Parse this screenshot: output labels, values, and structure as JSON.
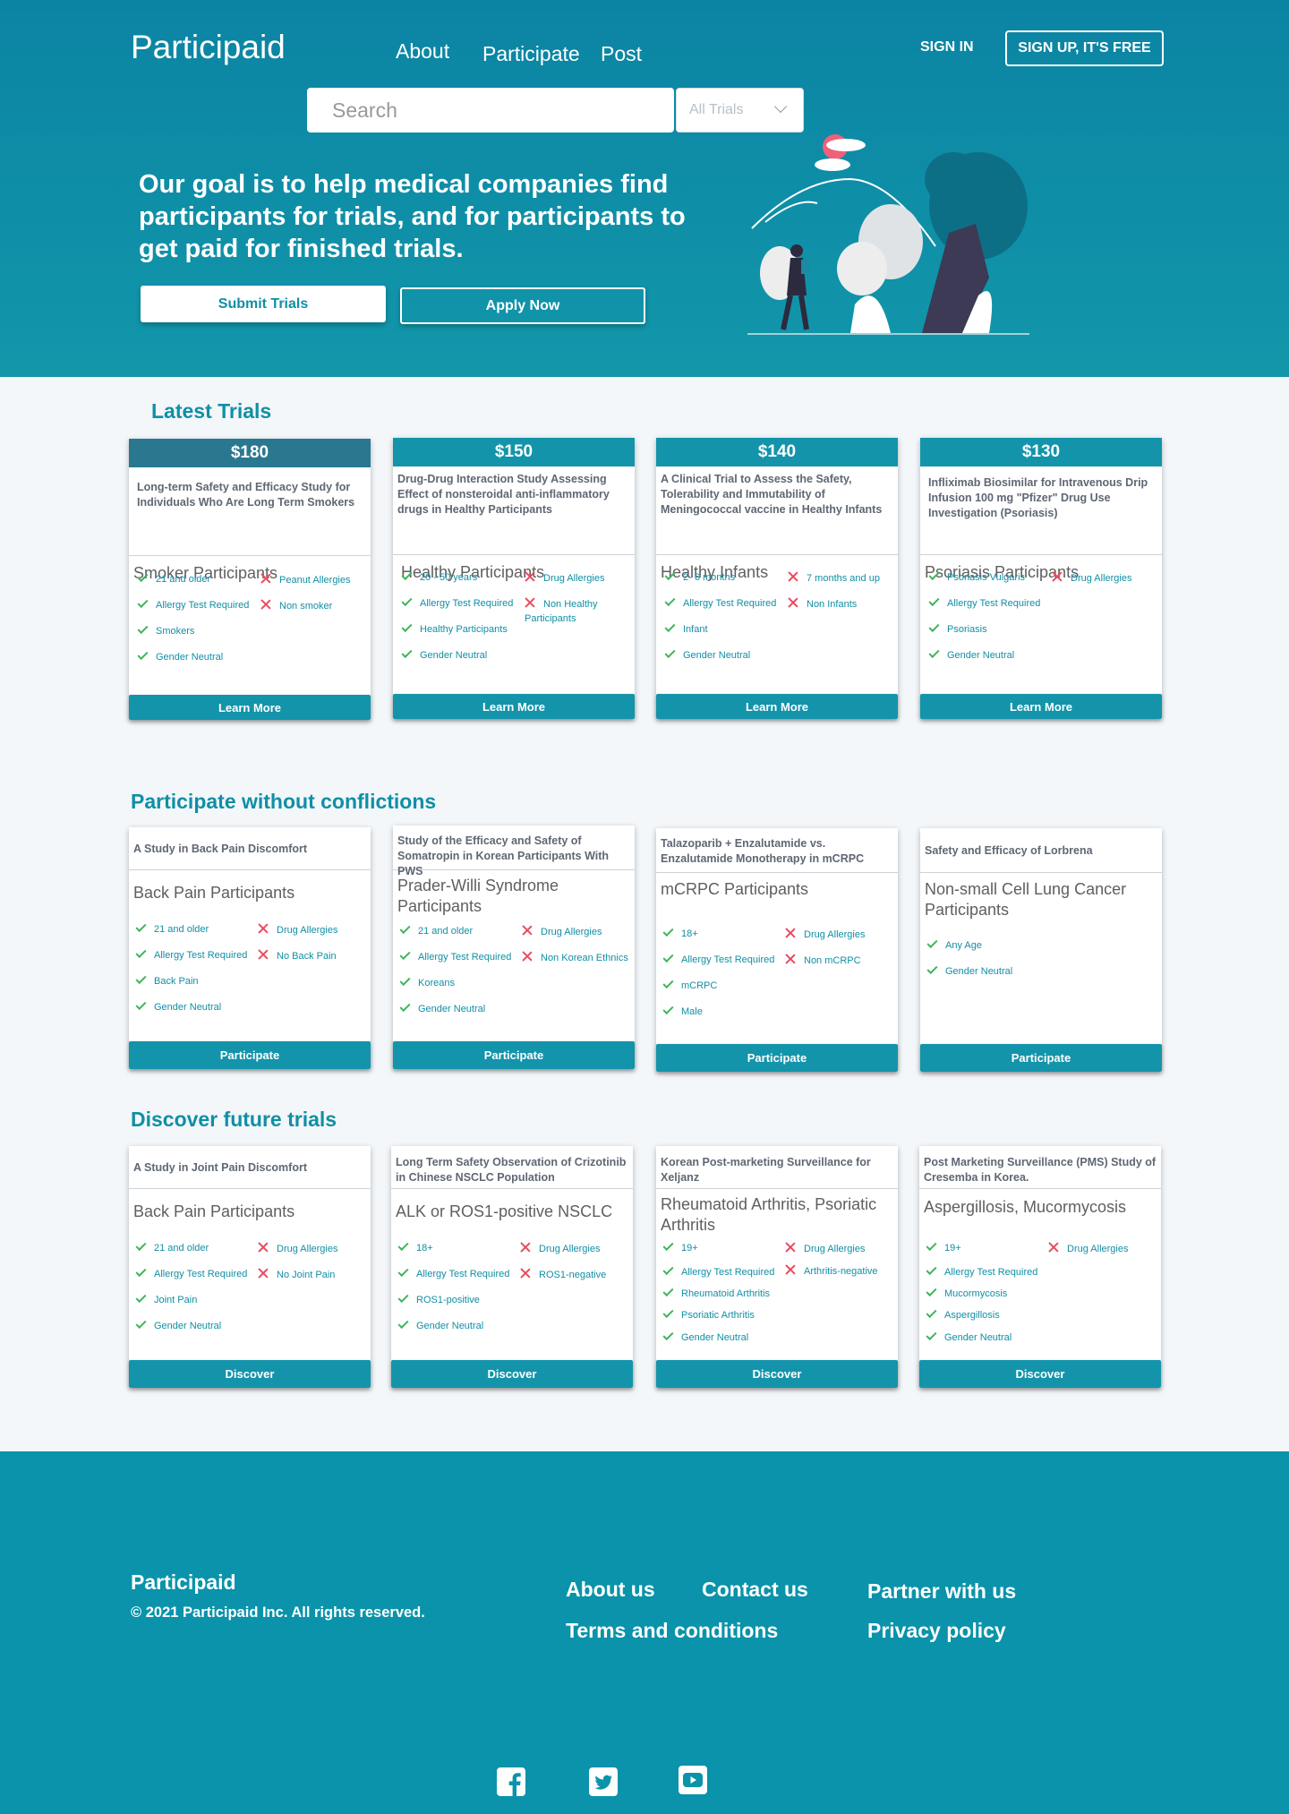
{
  "brand": "Participaid",
  "nav": {
    "about": "About",
    "participate": "Participate",
    "post": "Post"
  },
  "auth": {
    "sign_in": "SIGN IN",
    "sign_up": "SIGN UP, IT'S FREE"
  },
  "search": {
    "placeholder": "Search",
    "filter_value": "All Trials"
  },
  "hero": {
    "headline": "Our goal is to help medical companies find participants for trials, and for participants to get paid for finished trials.",
    "submit_label": "Submit Trials",
    "apply_label": "Apply Now"
  },
  "colors": {
    "primary": "#1394ab",
    "check": "#3eb45a",
    "cross": "#e84a5f",
    "bg": "#f3f7fa"
  },
  "latest": {
    "title": "Latest Trials",
    "cards": [
      {
        "price": "$180",
        "desc": "Long-term Safety and Efficacy Study for Individuals Who Are Long Term Smokers",
        "group": "Smoker Participants",
        "includes": [
          "21 and older",
          "Allergy Test Required",
          "Smokers",
          "Gender Neutral"
        ],
        "excludes": [
          "Peanut Allergies",
          "Non smoker"
        ],
        "button": "Learn More"
      },
      {
        "price": "$150",
        "desc": "Drug-Drug Interaction Study Assessing Effect of nonsteroidal anti-inflammatory drugs in Healthy Participants",
        "group": "Healthy Participants",
        "includes": [
          "20 - 50 years",
          "Allergy Test Required",
          "Healthy Participants",
          "Gender Neutral"
        ],
        "excludes": [
          "Drug Allergies",
          "Non Healthy Participants"
        ],
        "button": "Learn More"
      },
      {
        "price": "$140",
        "desc": "A Clinical Trial to Assess the Safety, Tolerability and Immutability of Meningococcal vaccine in Healthy Infants",
        "group": "Healthy Infants",
        "includes": [
          "2- 6 months",
          "Allergy Test Required",
          "Infant",
          "Gender Neutral"
        ],
        "excludes": [
          "7 months and up",
          "Non Infants"
        ],
        "button": "Learn More"
      },
      {
        "price": "$130",
        "desc": "Infliximab Biosimilar for Intravenous Drip Infusion 100 mg \"Pfizer\" Drug Use Investigation (Psoriasis)",
        "group": "Psoriasis Participants",
        "includes": [
          "Psoriasis Vulgaris",
          "Allergy Test Required",
          "Psoriasis",
          "Gender Neutral"
        ],
        "excludes": [
          "Drug Allergies"
        ],
        "button": "Learn More"
      }
    ]
  },
  "participate": {
    "title": "Participate without conflictions",
    "cards": [
      {
        "desc": "A Study in Back Pain Discomfort",
        "group": "Back Pain Participants",
        "includes": [
          "21 and older",
          "Allergy Test Required",
          "Back Pain",
          "Gender Neutral"
        ],
        "excludes": [
          "Drug Allergies",
          "No Back Pain"
        ],
        "button": "Participate"
      },
      {
        "desc": "Study of the Efficacy and Safety of Somatropin in Korean Participants With PWS",
        "group": "Prader-Willi Syndrome Participants",
        "includes": [
          "21 and older",
          "Allergy Test Required",
          "Koreans",
          "Gender Neutral"
        ],
        "excludes": [
          "Drug Allergies",
          "Non Korean Ethnics"
        ],
        "button": "Participate"
      },
      {
        "desc": "Talazoparib + Enzalutamide vs. Enzalutamide Monotherapy in mCRPC",
        "group": "mCRPC Participants",
        "includes": [
          "18+",
          "Allergy Test Required",
          "mCRPC",
          "Male"
        ],
        "excludes": [
          "Drug Allergies",
          "Non mCRPC"
        ],
        "button": "Participate"
      },
      {
        "desc": "Safety and Efficacy of Lorbrena",
        "group": "Non-small Cell Lung Cancer Participants",
        "includes": [
          "Any Age",
          "Gender Neutral"
        ],
        "excludes": [],
        "button": "Participate"
      }
    ]
  },
  "discover": {
    "title": "Discover future trials",
    "cards": [
      {
        "desc": "A Study in Joint Pain Discomfort",
        "group": "Back Pain Participants",
        "includes": [
          "21 and older",
          "Allergy Test Required",
          "Joint Pain",
          "Gender Neutral"
        ],
        "excludes": [
          "Drug Allergies",
          "No Joint Pain"
        ],
        "button": "Discover"
      },
      {
        "desc": "Long Term Safety Observation of Crizotinib in Chinese NSCLC Population",
        "group": "ALK or ROS1-positive NSCLC",
        "includes": [
          "18+",
          "Allergy Test Required",
          "ROS1-positive",
          "Gender Neutral"
        ],
        "excludes": [
          "Drug Allergies",
          "ROS1-negative"
        ],
        "button": "Discover"
      },
      {
        "desc": "Korean Post-marketing Surveillance for Xeljanz",
        "group": "Rheumatoid Arthritis, Psoriatic Arthritis",
        "includes": [
          "19+",
          "Allergy Test Required",
          "Rheumatoid Arthritis",
          "Psoriatic  Arthritis",
          "Gender Neutral"
        ],
        "excludes": [
          "Drug Allergies",
          "Arthritis-negative"
        ],
        "button": "Discover"
      },
      {
        "desc": "Post Marketing Surveillance (PMS) Study of Cresemba in Korea.",
        "group": "Aspergillosis, Mucormycosis",
        "includes": [
          "19+",
          "Allergy Test Required",
          "Mucormycosis",
          "Aspergillosis",
          "Gender Neutral"
        ],
        "excludes": [
          "Drug Allergies"
        ],
        "button": "Discover"
      }
    ]
  },
  "footer": {
    "brand": "Participaid",
    "copyright": "© 2021 Participaid Inc.  All rights reserved.",
    "links": {
      "about": "About us",
      "contact": "Contact us",
      "partner": "Partner with us",
      "terms": "Terms and conditions",
      "privacy": "Privacy policy"
    },
    "social": [
      "facebook-icon",
      "twitter-icon",
      "youtube-icon"
    ]
  }
}
